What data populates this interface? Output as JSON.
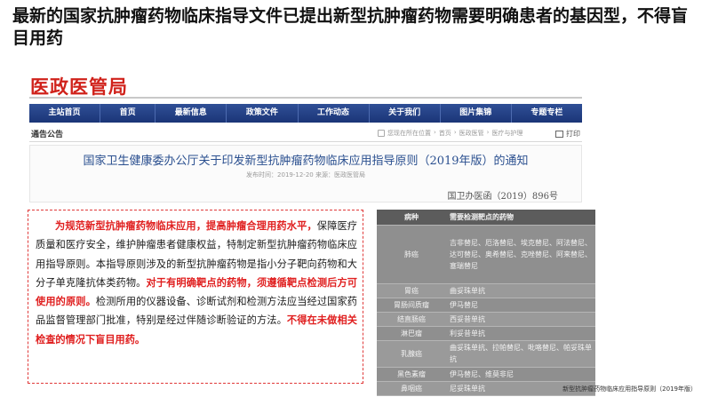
{
  "slide": {
    "title": "最新的国家抗肿瘤药物临床指导文件已提出新型抗肿瘤药物需要明确患者的基因型，不得盲目用药",
    "source_note": "新型抗肿瘤药物临床应用指导原则（2019年版）"
  },
  "site": {
    "logo": "医政医管局",
    "nav": [
      "主站首页",
      "首页",
      "最新信息",
      "政策文件",
      "工作动态",
      "关于我们",
      "图片集锦",
      "专题专栏"
    ],
    "section_label": "通告公告",
    "breadcrumb": [
      "您现在所在位置",
      "首页",
      "医政医管",
      "医疗与护理"
    ],
    "print_label": "打印"
  },
  "notice": {
    "title": "国家卫生健康委办公厅关于印发新型抗肿瘤药物临床应用指导原则（2019年版）的通知",
    "meta": "发布时间：2019-12-20    来源：医政医管局",
    "doc_number": "国卫办医函（2019）896号"
  },
  "excerpt": {
    "p1_hl1": "为规范新型抗肿瘤药物临床应用，提高肿瘤合理用药水平，",
    "p1_text1": "保障医疗质量和医疗安全，维护肿瘤患者健康权益，特制定新型抗肿瘤药物临床应用指导原则。本指导原则涉及的新型抗肿瘤药物是指小分子靶向药物和大分子单克隆抗体类药物。",
    "p1_hl2": "对于有明确靶点的药物，须遵循靶点检测后方可使用的原则。",
    "p1_text2": "检测所用的仪器设备、诊断试剂和检测方法应当经过国家药品监督管理部门批准，特别是经过伴随诊断验证的方法。",
    "p1_hl3": "不得在未做相关检查的情况下盲目用药。"
  },
  "table": {
    "headers": [
      "病种",
      "需要检测靶点的药物"
    ],
    "rows": [
      {
        "disease": "肺癌",
        "drugs": "吉非替尼、厄洛替尼、埃克替尼、阿法替尼、达可替尼、奥希替尼、克唑替尼、阿来替尼、塞瑞替尼"
      },
      {
        "disease": "胃癌",
        "drugs": "曲妥珠单抗"
      },
      {
        "disease": "胃肠间质瘤",
        "drugs": "伊马替尼"
      },
      {
        "disease": "结直肠癌",
        "drugs": "西妥昔单抗"
      },
      {
        "disease": "淋巴瘤",
        "drugs": "利妥昔单抗"
      },
      {
        "disease": "乳腺癌",
        "drugs": "曲妥珠单抗、拉帕替尼、吡咯替尼、帕妥珠单抗"
      },
      {
        "disease": "黑色素瘤",
        "drugs": "伊马替尼、维莫非尼"
      },
      {
        "disease": "鼻咽癌",
        "drugs": "尼妥珠单抗"
      }
    ]
  }
}
